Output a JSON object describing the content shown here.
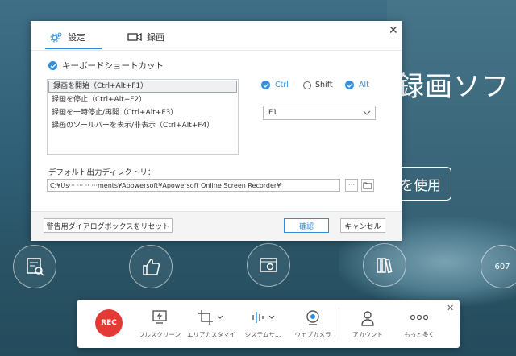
{
  "background": {
    "title": "録画ソフト",
    "button_label": "を使用",
    "badge_number": "607"
  },
  "dialog": {
    "tabs": [
      {
        "label": "設定",
        "icon": "gear-icon",
        "active": true
      },
      {
        "label": "録画",
        "icon": "video-camera-icon",
        "active": false
      }
    ],
    "shortcut_section_label": "キーボードショートカット",
    "shortcuts": [
      "録画を開始（Ctrl+Alt+F1）",
      "録画を停止（Ctrl+Alt+F2）",
      "録画を一時停止/再開（Ctrl+Alt+F3）",
      "録画のツールバーを表示/非表示（Ctrl+Alt+F4）"
    ],
    "modifiers": {
      "ctrl": {
        "label": "Ctrl",
        "checked": true
      },
      "shift": {
        "label": "Shift",
        "checked": false
      },
      "alt": {
        "label": "Alt",
        "checked": true
      }
    },
    "key_select_value": "F1",
    "output_dir_label": "デフォルト出力ディレクトリ：",
    "output_dir_value": "C:¥Us··· ··· ·· ···ments¥Apowersoft¥Apowersoft Online Screen Recorder¥",
    "browse_label": "···",
    "reset_button": "警告用ダイアログボックスをリセット",
    "ok_button": "確認",
    "cancel_button": "キャンセル",
    "accent_color": "#2f8ee0"
  },
  "toolbar": {
    "rec_label": "REC",
    "tools": [
      {
        "label": "フルスクリーン",
        "icon": "fullscreen-icon"
      },
      {
        "label": "エリアカスタマイズ",
        "icon": "crop-area-icon"
      },
      {
        "label": "システムサ…",
        "icon": "audio-wave-icon"
      },
      {
        "label": "ウェブカメラ",
        "icon": "webcam-icon"
      },
      {
        "label": "アカウント",
        "icon": "user-icon"
      },
      {
        "label": "もっと多く",
        "icon": "more-icon"
      }
    ]
  }
}
